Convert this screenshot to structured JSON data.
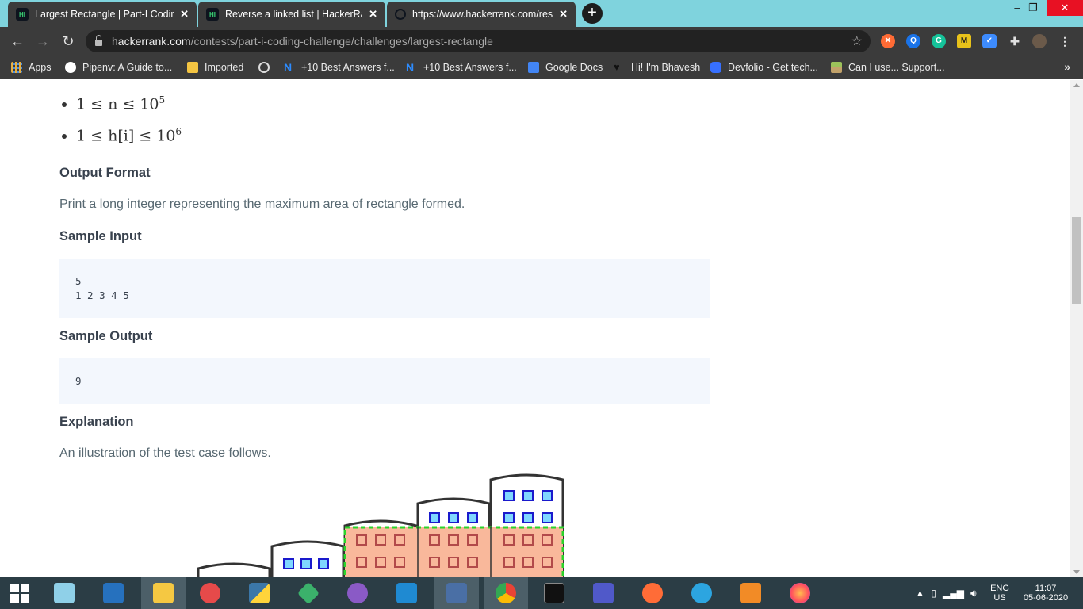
{
  "browser": {
    "tabs": [
      {
        "title": "Largest Rectangle | Part-I Coding",
        "favicon": "hackerrank-icon",
        "active": true
      },
      {
        "title": "Reverse a linked list | HackerRank",
        "favicon": "hackerrank-icon",
        "active": false
      },
      {
        "title": "https://www.hackerrank.com/rest",
        "favicon": "globe-icon",
        "active": false
      }
    ],
    "new_tab_label": "+",
    "window_controls": {
      "minimize": "–",
      "restore": "❐",
      "close": "✕"
    },
    "address": {
      "host": "hackerrank.com",
      "path": "/contests/part-i-coding-challenge/challenges/largest-rectangle"
    },
    "bookmarks": [
      {
        "label": "Apps",
        "icon": "apps-grid-icon",
        "color": "#e8b043"
      },
      {
        "label": "Pipenv: A Guide to...",
        "icon": "python-icon",
        "color": "#ffffff"
      },
      {
        "label": "Imported",
        "icon": "folder-icon",
        "color": "#f4c542"
      },
      {
        "label": "",
        "icon": "globe-icon",
        "color": "#dddddd"
      },
      {
        "label": "+10 Best Answers f...",
        "icon": "n-logo-icon",
        "color": "#2d8cff"
      },
      {
        "label": "+10 Best Answers f...",
        "icon": "n-logo-icon",
        "color": "#2d8cff"
      },
      {
        "label": "Google Docs",
        "icon": "docs-icon",
        "color": "#4285f4"
      },
      {
        "label": "Hi! I'm Bhavesh",
        "icon": "heart-icon",
        "color": "#111111"
      },
      {
        "label": "Devfolio - Get tech...",
        "icon": "devfolio-icon",
        "color": "#3770ff"
      },
      {
        "label": "Can I use... Support...",
        "icon": "caniuse-icon",
        "color": "#c2a26a"
      }
    ],
    "bookmarks_more": "»"
  },
  "content": {
    "constraints": [
      {
        "math": "1 ≤ n ≤ 10",
        "exp": "5"
      },
      {
        "math": "1 ≤ h[i] ≤ 10",
        "exp": "6"
      }
    ],
    "output_format_heading": "Output Format",
    "output_format_text": "Print a long integer representing the maximum area of rectangle formed.",
    "sample_input_heading": "Sample Input",
    "sample_input": "5\n1 2 3 4 5",
    "sample_output_heading": "Sample Output",
    "sample_output": "9",
    "explanation_heading": "Explanation",
    "explanation_text": "An illustration of the test case follows."
  },
  "taskbar": {
    "apps": [
      "windows-start-icon",
      "notepad-icon",
      "powershell-icon",
      "file-explorer-icon",
      "snipping-tool-icon",
      "python-icon",
      "git-kraken-icon",
      "github-desktop-icon",
      "vscode-icon",
      "devcpp-icon",
      "chrome-icon",
      "cmd-icon",
      "teams-icon",
      "postman-icon",
      "telegram-icon",
      "sublime-icon",
      "firefox-icon"
    ],
    "language": "ENG",
    "region": "US",
    "time": "11:07",
    "date": "05-06-2020"
  },
  "colors": {
    "tabbar": "#7fd3dd",
    "chrome_dark": "#3b3b3b",
    "taskbar": "#2b3d45",
    "building_highlight": "#f9b89b",
    "highlight_border": "#2bd42b",
    "window_fill": "#7fd7ff"
  }
}
